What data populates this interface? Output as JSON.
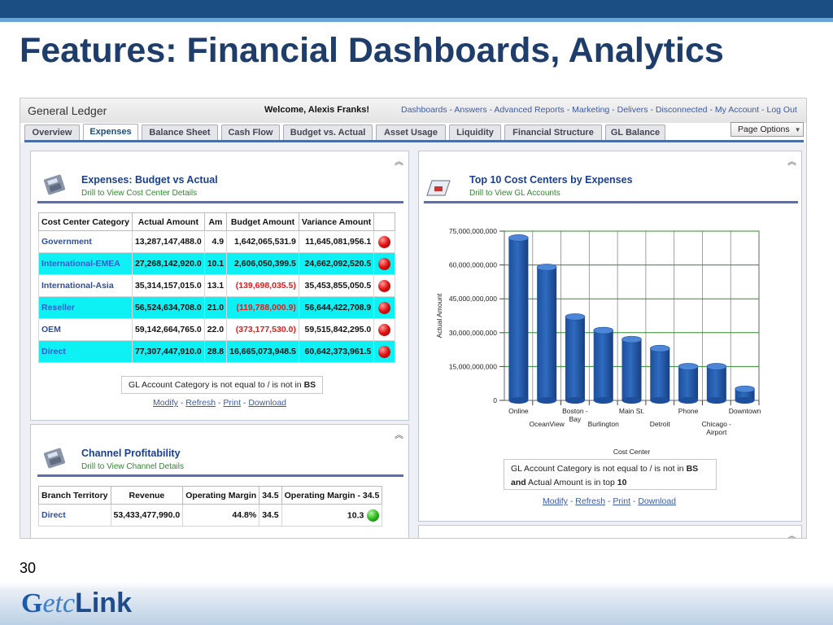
{
  "slide": {
    "title": "Features: Financial Dashboards, Analytics",
    "number": "30",
    "logo_g": "G",
    "logo_etc": "etc",
    "logo_link": "Link"
  },
  "app": {
    "title": "General Ledger",
    "welcome": "Welcome, Alexis Franks!",
    "links": [
      "Dashboards",
      "Answers",
      "Advanced Reports",
      "Marketing",
      "Delivers",
      "Disconnected",
      "My Account",
      "Log Out"
    ],
    "page_options": "Page Options"
  },
  "tabs": [
    {
      "label": "Overview"
    },
    {
      "label": "Expenses",
      "active": true
    },
    {
      "label": "Balance Sheet"
    },
    {
      "label": "Cash Flow"
    },
    {
      "label": "Budget vs. Actual"
    },
    {
      "label": "Asset Usage"
    },
    {
      "label": "Liquidity"
    },
    {
      "label": "Financial Structure"
    },
    {
      "label": "GL Balance"
    }
  ],
  "expenses_panel": {
    "title": "Expenses: Budget vs Actual",
    "subtitle": "Drill to View Cost Center Details",
    "columns": [
      "Cost Center Category",
      "Actual Amount",
      "Am",
      "Budget Amount",
      "Variance Amount"
    ],
    "rows": [
      {
        "cat": "Government",
        "actual": "13,287,147,488.0",
        "am": "4.9",
        "budget": "1,642,065,531.9",
        "variance": "11,645,081,956.1",
        "neg": false,
        "cyan": false
      },
      {
        "cat": "International-EMEA",
        "actual": "27,268,142,920.0",
        "am": "10.1",
        "budget": "2,606,050,399.5",
        "variance": "24,662,092,520.5",
        "neg": false,
        "cyan": true
      },
      {
        "cat": "International-Asia",
        "actual": "35,314,157,015.0",
        "am": "13.1",
        "budget": "(139,698,035.5)",
        "variance": "35,453,855,050.5",
        "neg": true,
        "cyan": false
      },
      {
        "cat": "Reseller",
        "actual": "56,524,634,708.0",
        "am": "21.0",
        "budget": "(119,788,000.9)",
        "variance": "56,644,422,708.9",
        "neg": true,
        "cyan": true
      },
      {
        "cat": "OEM",
        "actual": "59,142,664,765.0",
        "am": "22.0",
        "budget": "(373,177,530.0)",
        "variance": "59,515,842,295.0",
        "neg": true,
        "cyan": false
      },
      {
        "cat": "Direct",
        "actual": "77,307,447,910.0",
        "am": "28.8",
        "budget": "16,665,073,948.5",
        "variance": "60,642,373,961.5",
        "neg": false,
        "cyan": true
      }
    ],
    "filter_prefix": "GL Account Category is not equal to / is not in ",
    "filter_value": "BS",
    "actions": [
      "Modify",
      "Refresh",
      "Print",
      "Download"
    ]
  },
  "channel_panel": {
    "title": "Channel Profitability",
    "subtitle": "Drill to View Channel Details",
    "columns": [
      "Branch Territory",
      "Revenue",
      "Operating Margin",
      "34.5",
      "Operating Margin - 34.5"
    ],
    "rows": [
      {
        "territory": "Direct",
        "revenue": "53,433,477,990.0",
        "margin": "44.8%",
        "target": "34.5",
        "diff": "10.3",
        "status": "green"
      }
    ]
  },
  "cost_panel": {
    "title": "Top 10 Cost Centers by Expenses",
    "subtitle": "Drill to View GL Accounts",
    "filter_line1_prefix": "GL Account Category is not equal to / is not in ",
    "filter_line1_value": "BS",
    "filter_line2_and": "and",
    "filter_line2_text": " Actual Amount is in top ",
    "filter_line2_value": "10",
    "actions": [
      "Modify",
      "Refresh",
      "Print",
      "Download"
    ]
  },
  "chart_data": {
    "type": "bar",
    "title": "Top 10 Cost Centers by Expenses",
    "xlabel": "Cost Center",
    "ylabel": "Actual Amount",
    "ylim": [
      0,
      75000000000
    ],
    "y_ticks": [
      "75,000,000,000",
      "60,000,000,000",
      "45,000,000,000",
      "30,000,000,000",
      "15,000,000,000",
      "0"
    ],
    "categories": [
      "Online",
      "OceanView",
      "Boston - Bay",
      "Burlington",
      "Main St.",
      "Detroit",
      "Phone",
      "Chicago - Airport",
      "Downtown"
    ],
    "values": [
      72000000000,
      59000000000,
      37000000000,
      31000000000,
      27000000000,
      23000000000,
      15000000000,
      15000000000,
      5000000000
    ],
    "grid": true,
    "bar_color": "#2f6bbf"
  }
}
